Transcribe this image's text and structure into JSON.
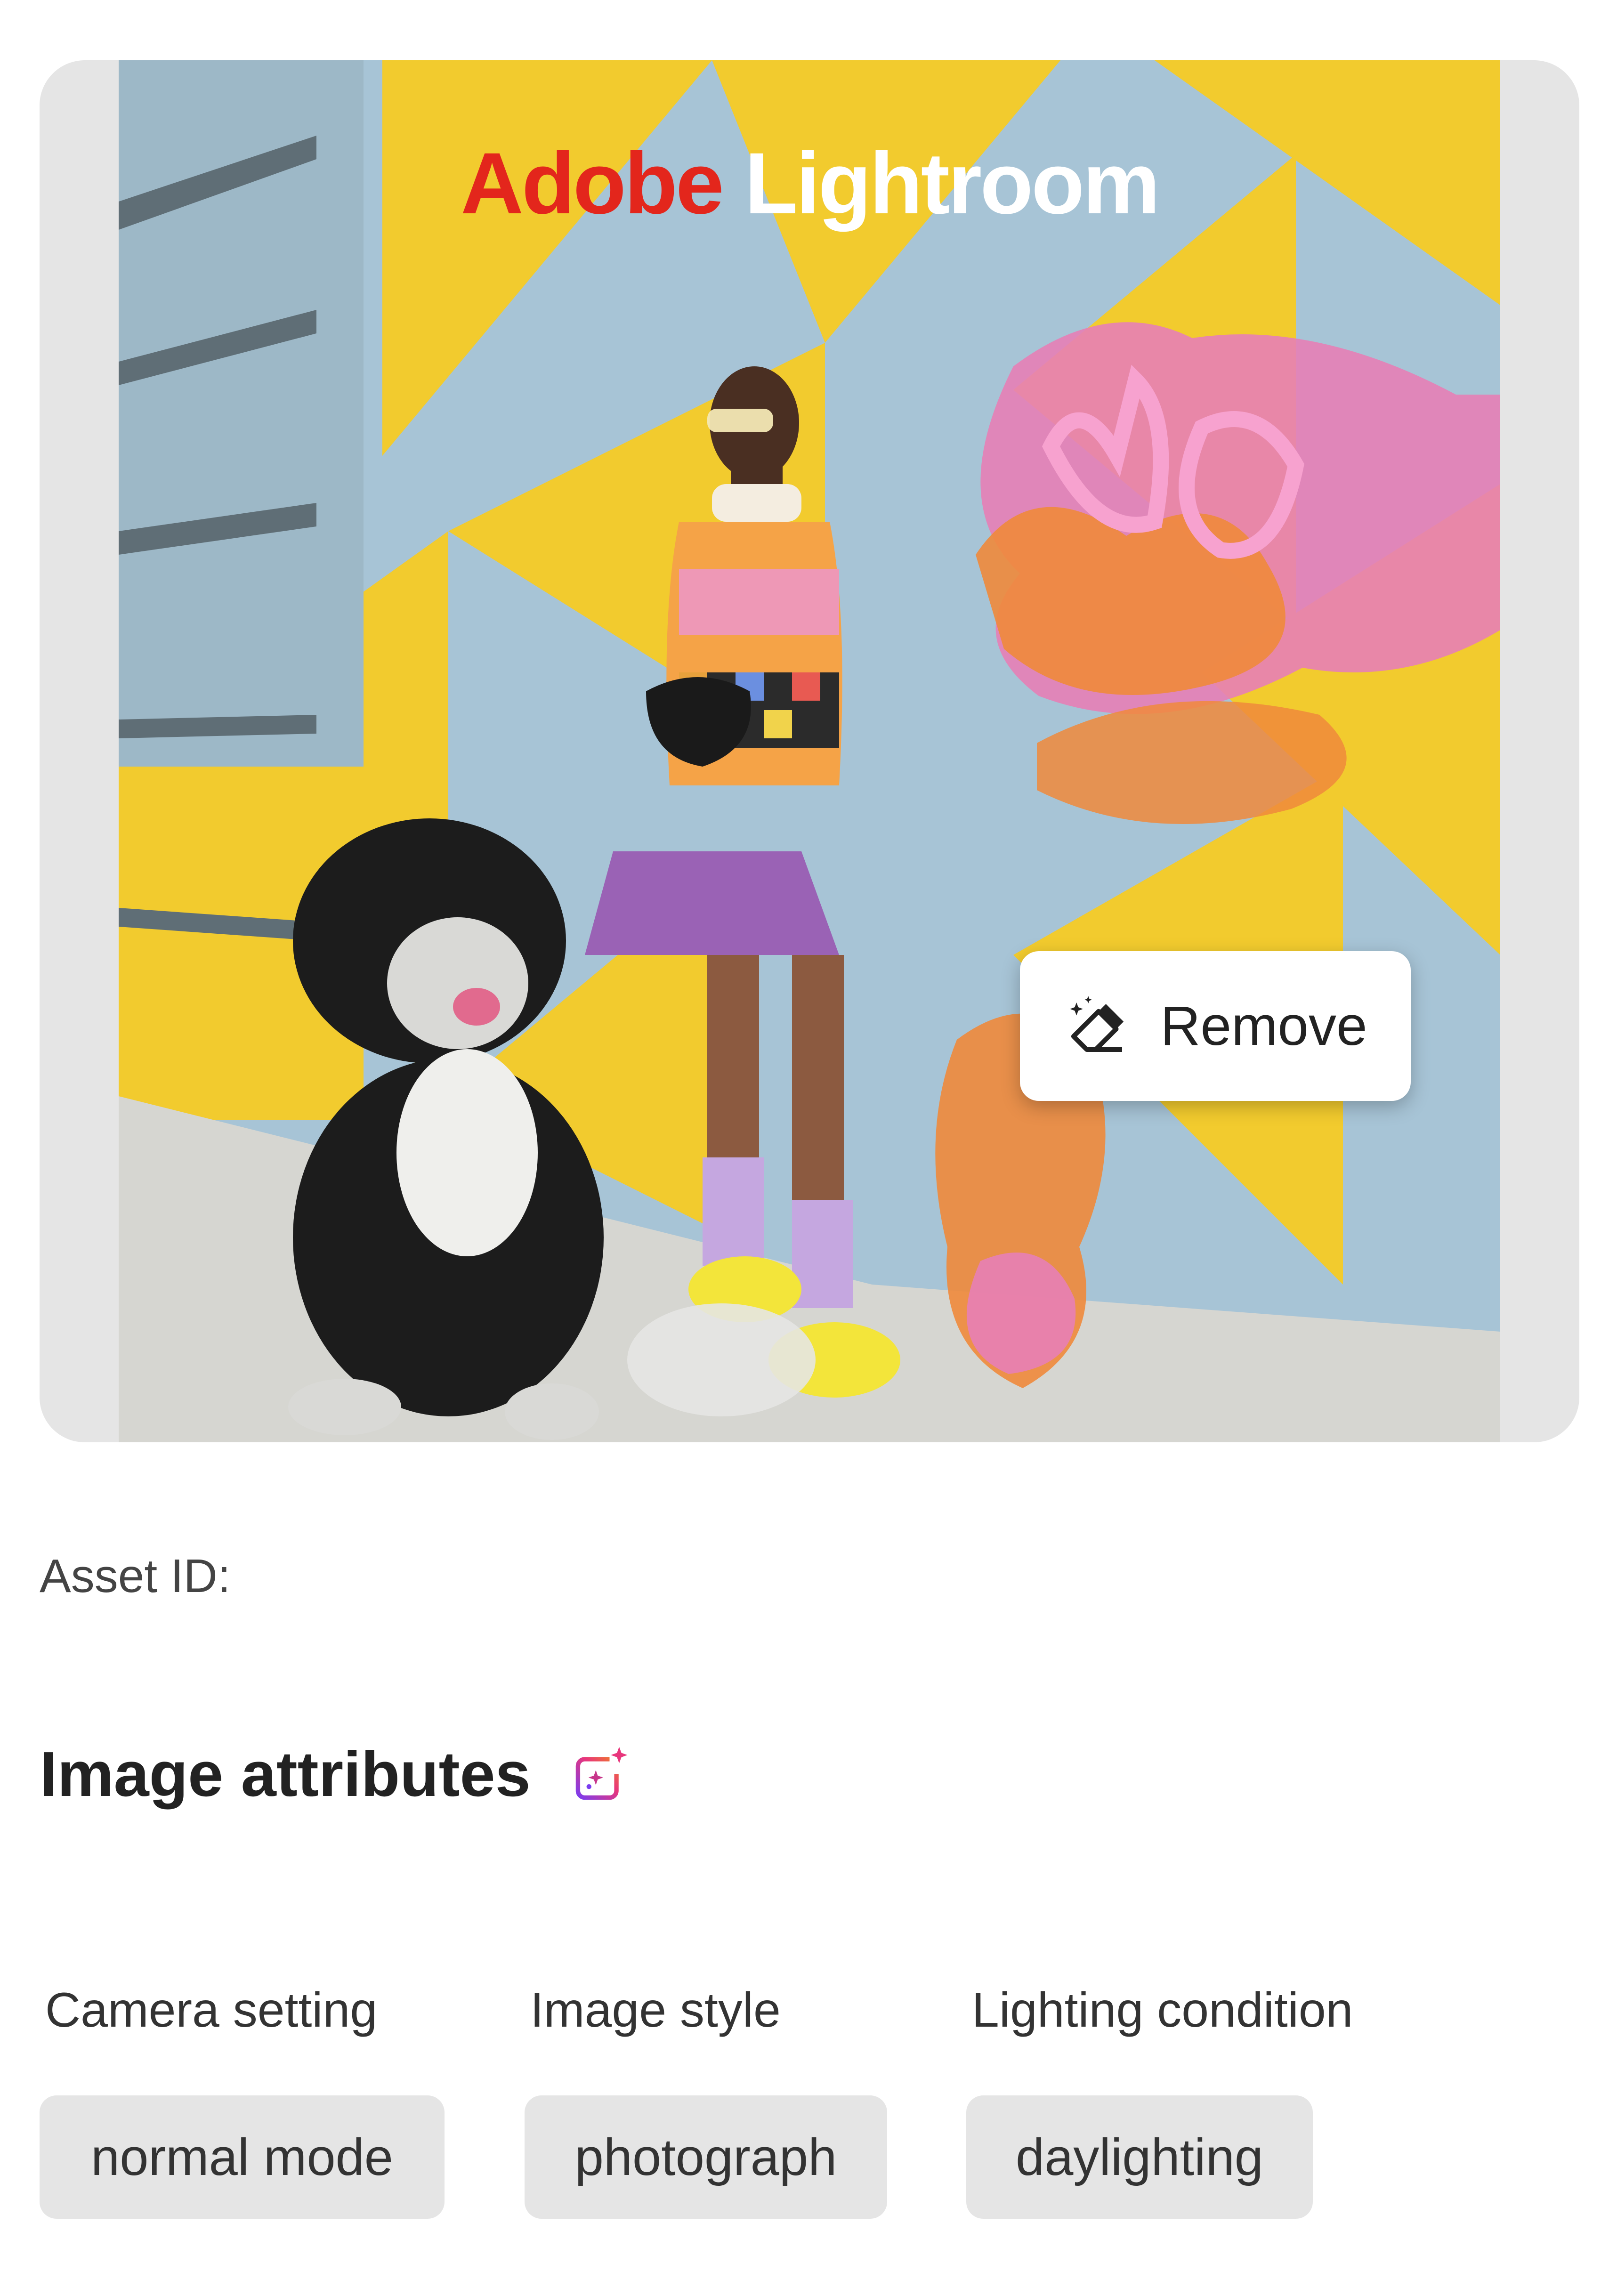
{
  "preview": {
    "brand_part1": "Adobe",
    "brand_part2": "Lightroom",
    "remove_label": "Remove",
    "brand_color": "#e3261c",
    "icon_name": "eraser-sparkle-icon"
  },
  "asset": {
    "label": "Asset ID:"
  },
  "attributes": {
    "title": "Image attributes",
    "icon_name": "ai-sparkle-icon",
    "items": [
      {
        "label": "Camera setting",
        "value": "normal mode"
      },
      {
        "label": "Image style",
        "value": "photograph"
      },
      {
        "label": "Lighting condition",
        "value": "daylighting"
      }
    ]
  }
}
